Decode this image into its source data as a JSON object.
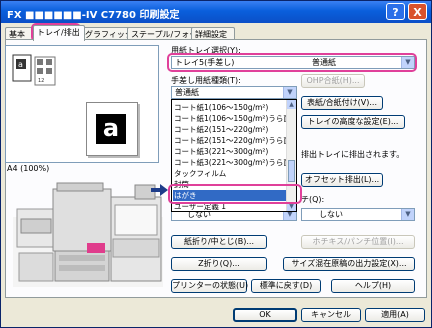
{
  "window": {
    "title": "FX ■■■■■■-IV C7780 印刷設定",
    "help_label": "?",
    "close_label": "X"
  },
  "tabs": [
    {
      "label": "基本"
    },
    {
      "label": "トレイ/排出"
    },
    {
      "label": "グラフィックス"
    },
    {
      "label": "ステープル/フォーム"
    },
    {
      "label": "詳細設定"
    }
  ],
  "preview": {
    "page_glyph": "a",
    "paper_label": "A4 (100%)"
  },
  "paper_tray": {
    "label": "用紙トレイ選択(Y):",
    "value_left": "トレイ5(手差し)",
    "value_right": "普通紙",
    "ohp_button": "OHP合紙(H)..."
  },
  "manual_paper": {
    "label": "手差し用紙種類(T):",
    "value": "普通紙",
    "cover_button": "表紙/合紙付け(V)...",
    "advanced_button": "トレイの高度な設定(E)..."
  },
  "dropdown_items": [
    {
      "label": "コート紙1(106～150g/m²)"
    },
    {
      "label": "コート紙1(106～150g/m²)うら面"
    },
    {
      "label": "コート紙2(151～220g/m²)"
    },
    {
      "label": "コート紙2(151～220g/m²)うら面"
    },
    {
      "label": "コート紙3(221～300g/m²)"
    },
    {
      "label": "コート紙3(221～300g/m²)うら面"
    },
    {
      "label": "タックフィルム"
    },
    {
      "label": "封筒"
    },
    {
      "label": "はがき",
      "selected": true
    },
    {
      "label": "ユーザー定義 1"
    }
  ],
  "output": {
    "note": "排出トレイに排出されます。",
    "offset_button": "オフセット排出(L)..."
  },
  "left_combo": {
    "value": "しない"
  },
  "right_combo": {
    "label_suffix": "チ(Q):",
    "value": "しない"
  },
  "buttons": {
    "folding": "紙折り/中とじ(B)...",
    "staple_pos": "ホチキス/パンチ位置(I)...",
    "z_fold": "Z折り(Q)...",
    "mixed_size": "サイズ混在原稿の出力設定(X)...",
    "printer_status": "プリンターの状態(U)",
    "restore_default": "標準に戻す(D)",
    "help": "ヘルプ(H)",
    "ok": "OK",
    "cancel": "キャンセル",
    "apply": "適用(A)"
  }
}
